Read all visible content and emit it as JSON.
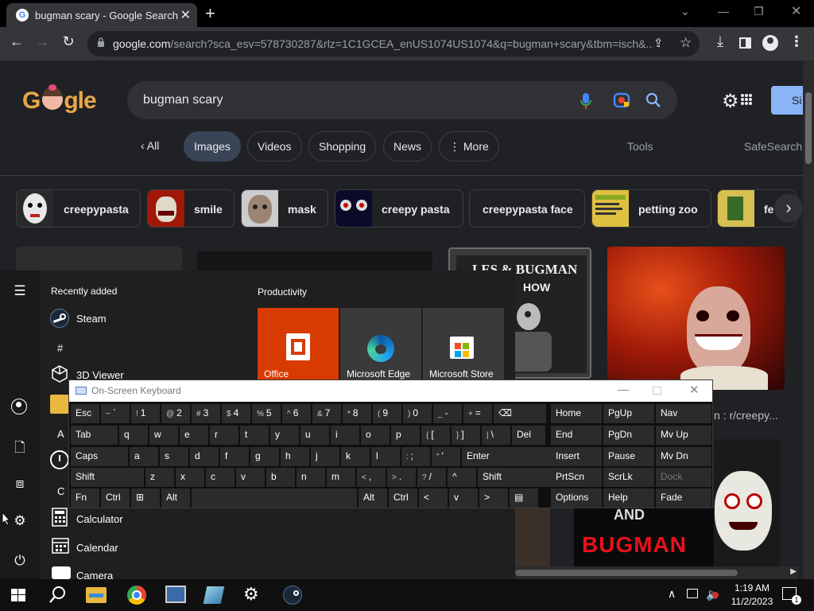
{
  "browser": {
    "tab_title": "bugman scary - Google Search",
    "url_host": "google.com",
    "url_rest": "/search?sca_esv=578730287&rlz=1C1GCEA_enUS1074US1074&q=bugman+scary&tbm=isch&..."
  },
  "google": {
    "query": "bugman scary",
    "signin_label": "Si",
    "nav": {
      "all": "All",
      "images": "Images",
      "videos": "Videos",
      "shopping": "Shopping",
      "news": "News",
      "more": "More",
      "tools": "Tools",
      "safesearch": "SafeSearch"
    },
    "related": [
      "creepypasta",
      "smile",
      "mask",
      "creepy pasta",
      "creepypasta face",
      "petting zoo",
      "fe"
    ],
    "results": {
      "caption_1": "n : r/creepy...",
      "poster_title": "LES & BUGMAN",
      "poster_sub": "HOW",
      "thumb_and": "AND",
      "thumb_bugman": "BUGMAN"
    }
  },
  "start_menu": {
    "recently_added": "Recently added",
    "productivity": "Productivity",
    "apps": [
      "Steam",
      "#",
      "3D Viewer",
      "A",
      "C",
      "Calculator",
      "Calendar",
      "Camera"
    ],
    "tiles": [
      "Office",
      "Microsoft Edge",
      "Microsoft Store"
    ]
  },
  "osk": {
    "title": "On-Screen Keyboard",
    "row1": [
      [
        "",
        "Esc"
      ],
      [
        "~",
        "`"
      ],
      [
        "!",
        "1"
      ],
      [
        "@",
        "2"
      ],
      [
        "#",
        "3"
      ],
      [
        "$",
        "4"
      ],
      [
        "%",
        "5"
      ],
      [
        "^",
        "6"
      ],
      [
        "&",
        "7"
      ],
      [
        "*",
        "8"
      ],
      [
        "(",
        "9"
      ],
      [
        ")",
        "0"
      ],
      [
        "_",
        "-"
      ],
      [
        "+",
        "="
      ],
      [
        "",
        "⌫"
      ]
    ],
    "row2": [
      [
        "",
        "Tab"
      ],
      [
        "",
        "q"
      ],
      [
        "",
        "w"
      ],
      [
        "",
        "e"
      ],
      [
        "",
        "r"
      ],
      [
        "",
        "t"
      ],
      [
        "",
        "y"
      ],
      [
        "",
        "u"
      ],
      [
        "",
        "i"
      ],
      [
        "",
        "o"
      ],
      [
        "",
        "p"
      ],
      [
        "{",
        "["
      ],
      [
        "}",
        "]"
      ],
      [
        "|",
        "\\"
      ],
      [
        "",
        "Del"
      ]
    ],
    "row3": [
      [
        "",
        "Caps"
      ],
      [
        "",
        "a"
      ],
      [
        "",
        "s"
      ],
      [
        "",
        "d"
      ],
      [
        "",
        "f"
      ],
      [
        "",
        "g"
      ],
      [
        "",
        "h"
      ],
      [
        "",
        "j"
      ],
      [
        "",
        "k"
      ],
      [
        "",
        "l"
      ],
      [
        ":",
        ";"
      ],
      [
        "\"",
        "'"
      ],
      [
        "",
        "Enter"
      ]
    ],
    "row4": [
      [
        "",
        "Shift"
      ],
      [
        "",
        "z"
      ],
      [
        "",
        "x"
      ],
      [
        "",
        "c"
      ],
      [
        "",
        "v"
      ],
      [
        "",
        "b"
      ],
      [
        "",
        "n"
      ],
      [
        "",
        "m"
      ],
      [
        "<",
        ","
      ],
      [
        ">",
        "."
      ],
      [
        "?",
        "/"
      ],
      [
        "",
        "^"
      ],
      [
        "",
        "Shift"
      ]
    ],
    "row5": [
      [
        "",
        "Fn"
      ],
      [
        "",
        "Ctrl"
      ],
      [
        "",
        "⊞"
      ],
      [
        "",
        "Alt"
      ],
      [
        "",
        ""
      ],
      [
        "",
        "Alt"
      ],
      [
        "",
        "Ctrl"
      ],
      [
        "",
        "<"
      ],
      [
        "",
        "v"
      ],
      [
        "",
        ">"
      ],
      [
        "",
        "▤"
      ]
    ],
    "nav_keys": [
      [
        "Home",
        "PgUp",
        "Nav"
      ],
      [
        "End",
        "PgDn",
        "Mv Up"
      ],
      [
        "Insert",
        "Pause",
        "Mv Dn"
      ],
      [
        "PrtScn",
        "ScrLk",
        "Dock"
      ],
      [
        "Options",
        "Help",
        "Fade"
      ]
    ]
  },
  "taskbar": {
    "time": "1:19 AM",
    "date": "11/2/2023",
    "notifications": "1"
  }
}
